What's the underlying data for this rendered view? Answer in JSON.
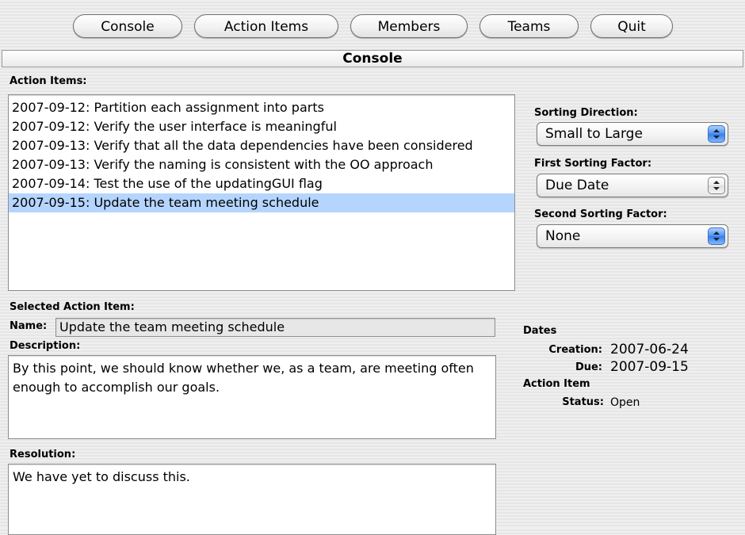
{
  "toolbar": {
    "buttons": [
      "Console",
      "Action Items",
      "Members",
      "Teams",
      "Quit"
    ]
  },
  "header": {
    "title": "Console"
  },
  "action_items": {
    "label": "Action Items:",
    "items": [
      "2007-09-12: Partition each assignment into parts",
      "2007-09-12: Verify the user interface is meaningful",
      "2007-09-13: Verify that all the data dependencies have been considered",
      "2007-09-13: Verify the naming is consistent with the OO approach",
      "2007-09-14: Test the use of the updatingGUI flag",
      "2007-09-15: Update the team meeting schedule"
    ],
    "selected_index": 5
  },
  "sorting": {
    "direction_label": "Sorting Direction:",
    "direction_value": "Small to Large",
    "first_label": "First Sorting Factor:",
    "first_value": "Due Date",
    "second_label": "Second Sorting Factor:",
    "second_value": "None"
  },
  "selected": {
    "section_label": "Selected Action Item:",
    "name_label": "Name:",
    "name_value": "Update the team meeting schedule",
    "description_label": "Description:",
    "description_value": "By this point, we should know whether we, as a team, are meeting often enough to accomplish our goals.",
    "resolution_label": "Resolution:",
    "resolution_value": "We have yet to discuss this."
  },
  "dates": {
    "heading": "Dates",
    "creation_label": "Creation:",
    "creation_value": "2007-06-24",
    "due_label": "Due:",
    "due_value": "2007-09-15",
    "action_item_heading": "Action Item",
    "status_label": "Status:",
    "status_value": "Open"
  },
  "colors": {
    "selection": "#b5d5ff",
    "popup_arrow_active": "#4a90f0"
  }
}
